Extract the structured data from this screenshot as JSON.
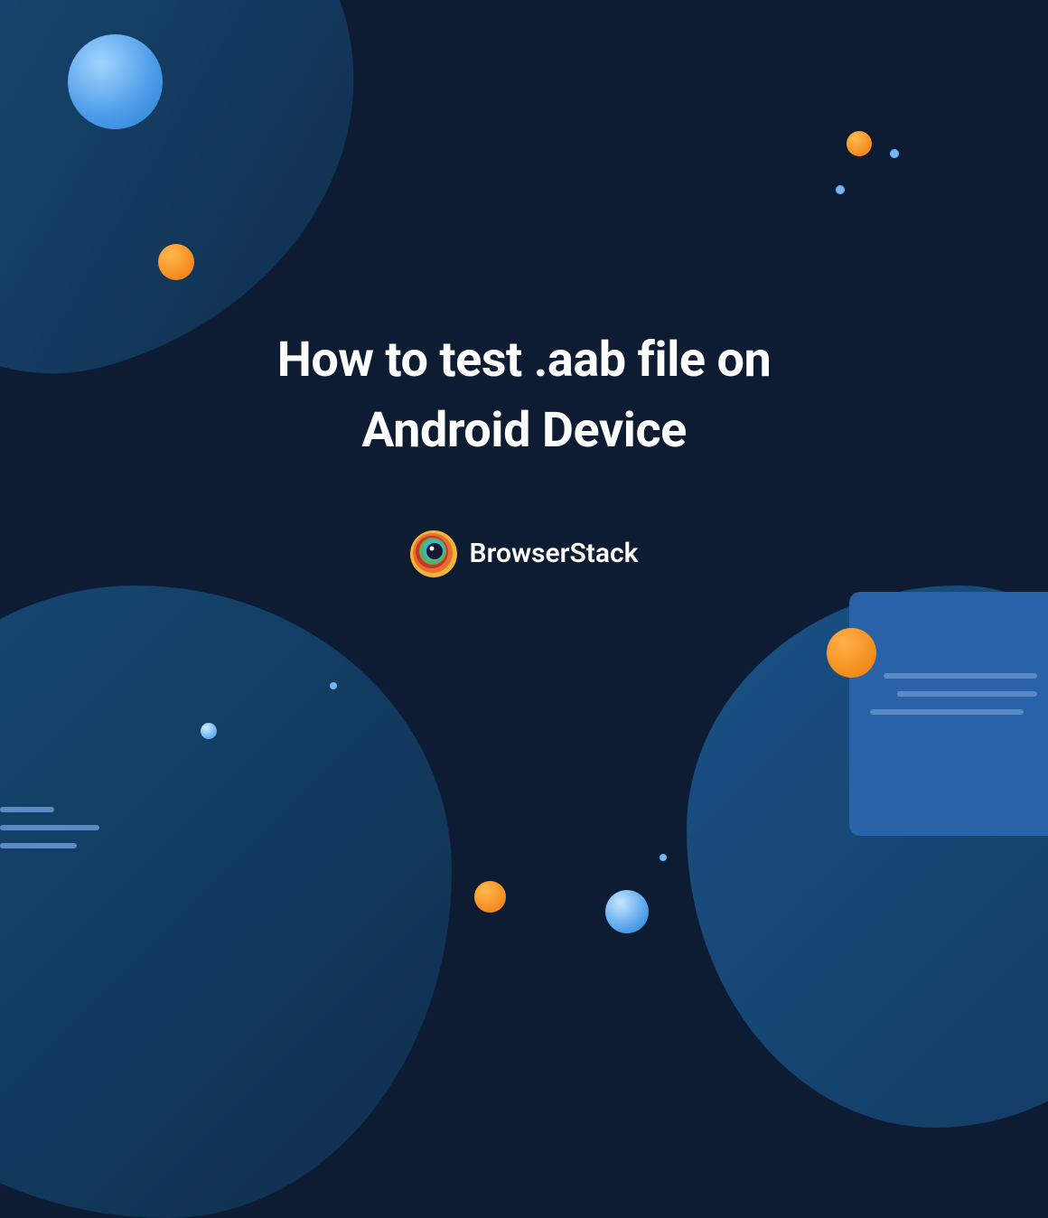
{
  "hero": {
    "title_line1": "How to test .aab file on",
    "title_line2": "Android Device"
  },
  "brand": {
    "name": "BrowserStack"
  },
  "colors": {
    "background": "#0d1b33",
    "accent_orange": "#f58a1f",
    "accent_blue": "#4a9be8",
    "text": "#ffffff"
  }
}
